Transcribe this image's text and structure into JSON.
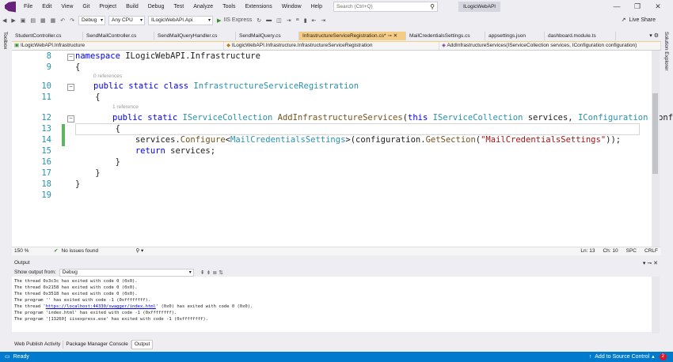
{
  "menu": {
    "items": [
      "File",
      "Edit",
      "View",
      "Git",
      "Project",
      "Build",
      "Debug",
      "Test",
      "Analyze",
      "Tools",
      "Extensions",
      "Window",
      "Help"
    ],
    "search_placeholder": "Search (Ctrl+Q)",
    "project_name": "ILogicWebAPI"
  },
  "toolbar": {
    "config": "Debug",
    "platform": "Any CPU",
    "startup_project": "ILogicWebAPI.Api",
    "run_target": "IIS Express",
    "live_share": "Live Share"
  },
  "side": {
    "left": "Toolbox",
    "right": "Solution Explorer"
  },
  "tabs": [
    {
      "label": "StudentController.cs",
      "active": false
    },
    {
      "label": "SendMailController.cs",
      "active": false
    },
    {
      "label": "SendMailQueryHandler.cs",
      "active": false
    },
    {
      "label": "SendMailQuery.cs",
      "active": false
    },
    {
      "label": "InfrastructureServiceRegistration.cs*",
      "active": true
    },
    {
      "label": "MailCredentialsSettings.cs",
      "active": false
    },
    {
      "label": "appsettings.json",
      "active": false
    },
    {
      "label": "dashboard.module.ts",
      "active": false
    }
  ],
  "navbar": {
    "project": "ILogicWebAPI.Infrastructure",
    "type": "ILogicWebAPI.Infrastructure.InfrastructureServiceRegistration",
    "member": "AddInfrastructureServices(IServiceCollection services, IConfiguration configuration)"
  },
  "code": {
    "line_numbers": [
      "8",
      "9",
      "10",
      "11",
      "12",
      "13",
      "14",
      "15",
      "16",
      "17",
      "18",
      "19"
    ],
    "refs0": "0 references",
    "refs1": "1 reference",
    "l8_kw": "namespace",
    "l8_name": " ILogicWebAPI.Infrastructure",
    "l9": "{",
    "l10_kw": "public static class",
    "l10_name": " InfrastructureServiceRegistration",
    "l11": "    {",
    "l12_kw": "public static",
    "l12_type": " IServiceCollection",
    "l12_method": " AddInfrastructureServices",
    "l12_p1": "(",
    "l12_this": "this",
    "l12_type2": " IServiceCollection",
    "l12_p2": " services, ",
    "l12_type3": "IConfiguration",
    "l12_p3": " configu",
    "l13": "        {",
    "l14_a": "            services.",
    "l14_m": "Configure",
    "l14_b": "<",
    "l14_t": "MailCredentialsSettings",
    "l14_c": ">(configuration.",
    "l14_m2": "GetSection",
    "l14_d": "(",
    "l14_s": "\"MailCredentialsSettings\"",
    "l14_e": "));",
    "l15_kw": "            return",
    "l15_b": " services;",
    "l16": "        }",
    "l17": "    }",
    "l18": "}"
  },
  "editor_status": {
    "zoom": "150 %",
    "issues": "No issues found",
    "ln": "Ln: 13",
    "ch": "Ch: 10",
    "spc": "SPC",
    "crlf": "CRLF"
  },
  "output": {
    "title": "Output",
    "show_from_label": "Show output from:",
    "source": "Debug",
    "lines": [
      "The thread 0x3c3c has exited with code 0 (0x0).",
      "The thread 0x2158 has exited with code 0 (0x0).",
      "The thread 0x3518 has exited with code 0 (0x0).",
      "The program '' has exited with code -1 (0xffffffff).",
      "The program 'index.html' has exited with code -1 (0xffffffff).",
      "The program '[13260] iisexpress.exe' has exited with code -1 (0xffffffff)."
    ],
    "url_line_prefix": "The thread '",
    "url": "https://localhost:44330/swagger/index.html",
    "url_line_suffix": "' (0x0) has exited with code 0 (0x0).",
    "tabs": [
      "Web Publish Activity",
      "Package Manager Console",
      "Output"
    ]
  },
  "status": {
    "ready": "Ready",
    "source_control": "Add to Source Control",
    "badge": "2"
  }
}
